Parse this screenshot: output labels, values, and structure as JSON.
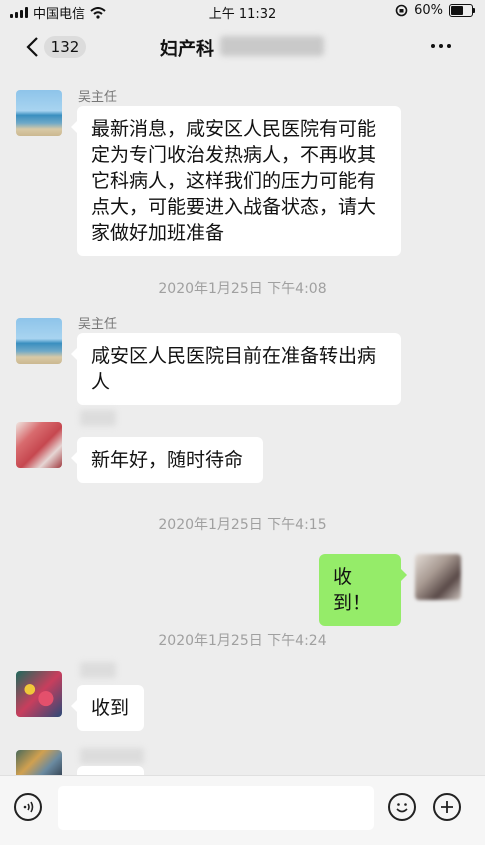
{
  "status_bar": {
    "carrier": "中国电信",
    "time": "上午 11:32",
    "battery": "60%",
    "battery_level": 0.6
  },
  "header": {
    "unread_count": "132",
    "title": "妇产科"
  },
  "messages": [
    {
      "sender": "吴主任",
      "text": "最新消息，咸安区人民医院有可能定为专门收治发热病人，不再收其它科病人，这样我们的压力可能有点大，可能要进入战备状态，请大家做好加班准备"
    },
    {
      "timestamp": "2020年1月25日 下午4:08"
    },
    {
      "sender": "吴主任",
      "text": "咸安区人民医院目前在准备转出病人"
    },
    {
      "text": "新年好，随时待命"
    },
    {
      "timestamp": "2020年1月25日 下午4:15"
    },
    {
      "text": "收到！"
    },
    {
      "timestamp": "2020年1月25日 下午4:24"
    },
    {
      "text": "收到"
    }
  ]
}
